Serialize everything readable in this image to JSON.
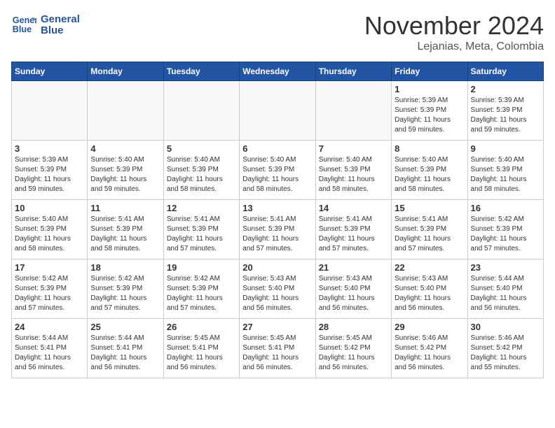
{
  "header": {
    "logo_line1": "General",
    "logo_line2": "Blue",
    "month": "November 2024",
    "location": "Lejanias, Meta, Colombia"
  },
  "weekdays": [
    "Sunday",
    "Monday",
    "Tuesday",
    "Wednesday",
    "Thursday",
    "Friday",
    "Saturday"
  ],
  "weeks": [
    [
      {
        "day": "",
        "info": ""
      },
      {
        "day": "",
        "info": ""
      },
      {
        "day": "",
        "info": ""
      },
      {
        "day": "",
        "info": ""
      },
      {
        "day": "",
        "info": ""
      },
      {
        "day": "1",
        "info": "Sunrise: 5:39 AM\nSunset: 5:39 PM\nDaylight: 11 hours\nand 59 minutes."
      },
      {
        "day": "2",
        "info": "Sunrise: 5:39 AM\nSunset: 5:39 PM\nDaylight: 11 hours\nand 59 minutes."
      }
    ],
    [
      {
        "day": "3",
        "info": "Sunrise: 5:39 AM\nSunset: 5:39 PM\nDaylight: 11 hours\nand 59 minutes."
      },
      {
        "day": "4",
        "info": "Sunrise: 5:40 AM\nSunset: 5:39 PM\nDaylight: 11 hours\nand 59 minutes."
      },
      {
        "day": "5",
        "info": "Sunrise: 5:40 AM\nSunset: 5:39 PM\nDaylight: 11 hours\nand 58 minutes."
      },
      {
        "day": "6",
        "info": "Sunrise: 5:40 AM\nSunset: 5:39 PM\nDaylight: 11 hours\nand 58 minutes."
      },
      {
        "day": "7",
        "info": "Sunrise: 5:40 AM\nSunset: 5:39 PM\nDaylight: 11 hours\nand 58 minutes."
      },
      {
        "day": "8",
        "info": "Sunrise: 5:40 AM\nSunset: 5:39 PM\nDaylight: 11 hours\nand 58 minutes."
      },
      {
        "day": "9",
        "info": "Sunrise: 5:40 AM\nSunset: 5:39 PM\nDaylight: 11 hours\nand 58 minutes."
      }
    ],
    [
      {
        "day": "10",
        "info": "Sunrise: 5:40 AM\nSunset: 5:39 PM\nDaylight: 11 hours\nand 58 minutes."
      },
      {
        "day": "11",
        "info": "Sunrise: 5:41 AM\nSunset: 5:39 PM\nDaylight: 11 hours\nand 58 minutes."
      },
      {
        "day": "12",
        "info": "Sunrise: 5:41 AM\nSunset: 5:39 PM\nDaylight: 11 hours\nand 57 minutes."
      },
      {
        "day": "13",
        "info": "Sunrise: 5:41 AM\nSunset: 5:39 PM\nDaylight: 11 hours\nand 57 minutes."
      },
      {
        "day": "14",
        "info": "Sunrise: 5:41 AM\nSunset: 5:39 PM\nDaylight: 11 hours\nand 57 minutes."
      },
      {
        "day": "15",
        "info": "Sunrise: 5:41 AM\nSunset: 5:39 PM\nDaylight: 11 hours\nand 57 minutes."
      },
      {
        "day": "16",
        "info": "Sunrise: 5:42 AM\nSunset: 5:39 PM\nDaylight: 11 hours\nand 57 minutes."
      }
    ],
    [
      {
        "day": "17",
        "info": "Sunrise: 5:42 AM\nSunset: 5:39 PM\nDaylight: 11 hours\nand 57 minutes."
      },
      {
        "day": "18",
        "info": "Sunrise: 5:42 AM\nSunset: 5:39 PM\nDaylight: 11 hours\nand 57 minutes."
      },
      {
        "day": "19",
        "info": "Sunrise: 5:42 AM\nSunset: 5:39 PM\nDaylight: 11 hours\nand 57 minutes."
      },
      {
        "day": "20",
        "info": "Sunrise: 5:43 AM\nSunset: 5:40 PM\nDaylight: 11 hours\nand 56 minutes."
      },
      {
        "day": "21",
        "info": "Sunrise: 5:43 AM\nSunset: 5:40 PM\nDaylight: 11 hours\nand 56 minutes."
      },
      {
        "day": "22",
        "info": "Sunrise: 5:43 AM\nSunset: 5:40 PM\nDaylight: 11 hours\nand 56 minutes."
      },
      {
        "day": "23",
        "info": "Sunrise: 5:44 AM\nSunset: 5:40 PM\nDaylight: 11 hours\nand 56 minutes."
      }
    ],
    [
      {
        "day": "24",
        "info": "Sunrise: 5:44 AM\nSunset: 5:41 PM\nDaylight: 11 hours\nand 56 minutes."
      },
      {
        "day": "25",
        "info": "Sunrise: 5:44 AM\nSunset: 5:41 PM\nDaylight: 11 hours\nand 56 minutes."
      },
      {
        "day": "26",
        "info": "Sunrise: 5:45 AM\nSunset: 5:41 PM\nDaylight: 11 hours\nand 56 minutes."
      },
      {
        "day": "27",
        "info": "Sunrise: 5:45 AM\nSunset: 5:41 PM\nDaylight: 11 hours\nand 56 minutes."
      },
      {
        "day": "28",
        "info": "Sunrise: 5:45 AM\nSunset: 5:42 PM\nDaylight: 11 hours\nand 56 minutes."
      },
      {
        "day": "29",
        "info": "Sunrise: 5:46 AM\nSunset: 5:42 PM\nDaylight: 11 hours\nand 56 minutes."
      },
      {
        "day": "30",
        "info": "Sunrise: 5:46 AM\nSunset: 5:42 PM\nDaylight: 11 hours\nand 55 minutes."
      }
    ]
  ]
}
